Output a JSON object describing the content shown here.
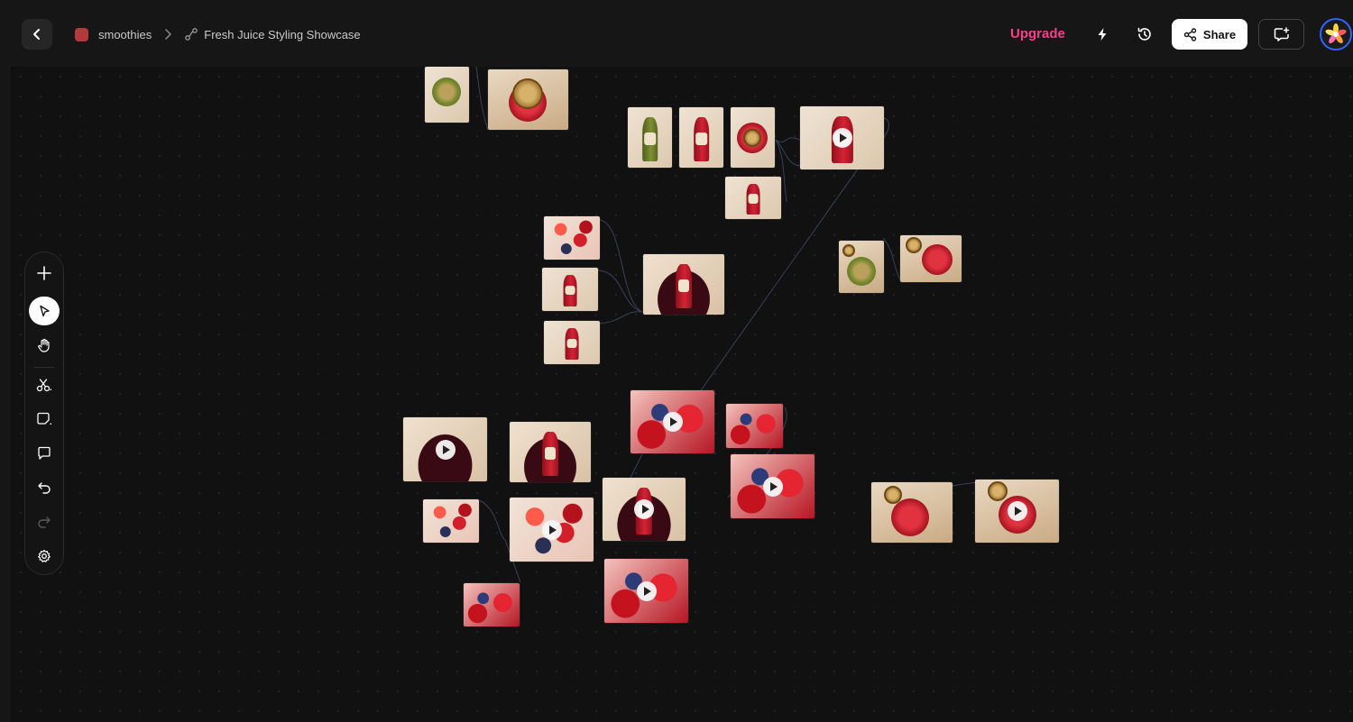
{
  "header": {
    "project_name": "smoothies",
    "project_color": "#b33a3a",
    "canvas_name": "Fresh Juice Styling Showcase",
    "upgrade_label": "Upgrade",
    "upgrade_color": "#ff3d8b",
    "share_label": "Share",
    "icons": {
      "back": "chevron-left-icon",
      "separator": "chevron-right-icon",
      "canvas": "flow-icon",
      "quick": "lightning-icon",
      "history": "history-icon",
      "share": "share-icon",
      "present": "present-icon",
      "avatar": "flower-avatar"
    }
  },
  "toolbar": {
    "tools": [
      {
        "name": "add",
        "icon": "plus-icon"
      },
      {
        "name": "select",
        "icon": "cursor-icon",
        "active": true
      },
      {
        "name": "pan",
        "icon": "hand-icon"
      },
      {
        "name": "cut",
        "icon": "scissors-icon"
      },
      {
        "name": "note",
        "icon": "sticky-note-icon"
      },
      {
        "name": "comment",
        "icon": "comment-icon"
      },
      {
        "name": "undo",
        "icon": "undo-icon"
      },
      {
        "name": "redo",
        "icon": "redo-icon",
        "disabled": true
      },
      {
        "name": "settings",
        "icon": "gear-icon"
      }
    ]
  },
  "canvas": {
    "nodes": [
      {
        "name": "green-jar-lid",
        "style": "lid-green-jar",
        "video": false
      },
      {
        "name": "red-jar-lid",
        "style": "lid-red-jar",
        "video": false
      },
      {
        "name": "green-bottle",
        "style": "bottle-green",
        "video": false
      },
      {
        "name": "red-bottle",
        "style": "bottle-red",
        "video": false
      },
      {
        "name": "jar-topdown",
        "style": "jar-top",
        "video": false
      },
      {
        "name": "red-bottle-video",
        "style": "bottle-red-wide",
        "video": true
      },
      {
        "name": "red-bottle-small",
        "style": "bottle-red",
        "video": false
      },
      {
        "name": "berry-cluster",
        "style": "berries",
        "video": false
      },
      {
        "name": "red-bottle-2",
        "style": "bottle-red",
        "video": false
      },
      {
        "name": "red-bottle-3",
        "style": "bottle-red",
        "video": false
      },
      {
        "name": "bottle-in-cherries",
        "style": "bottle-cherry",
        "video": false
      },
      {
        "name": "green-jam-jar",
        "style": "green-jam",
        "video": false
      },
      {
        "name": "red-jam-jar",
        "style": "red-jam",
        "video": false
      },
      {
        "name": "cherry-pile-video",
        "style": "cherry-pile",
        "video": true
      },
      {
        "name": "bottle-cherries-2",
        "style": "bottle-cherry",
        "video": false
      },
      {
        "name": "splash-video-1",
        "style": "splash",
        "video": true
      },
      {
        "name": "berries-small",
        "style": "splash",
        "video": false
      },
      {
        "name": "strawberry-small",
        "style": "berries",
        "video": false
      },
      {
        "name": "strawberry-video",
        "style": "berries",
        "video": true
      },
      {
        "name": "bottle-cherries-video",
        "style": "bottle-cherry",
        "video": true
      },
      {
        "name": "splash-video-2",
        "style": "splash",
        "video": true
      },
      {
        "name": "splash-small",
        "style": "splash",
        "video": false
      },
      {
        "name": "splash-video-3",
        "style": "splash",
        "video": true
      },
      {
        "name": "red-jam-open",
        "style": "red-jam-open",
        "video": false
      },
      {
        "name": "red-jam-video",
        "style": "red-jam-open",
        "video": true
      }
    ]
  }
}
